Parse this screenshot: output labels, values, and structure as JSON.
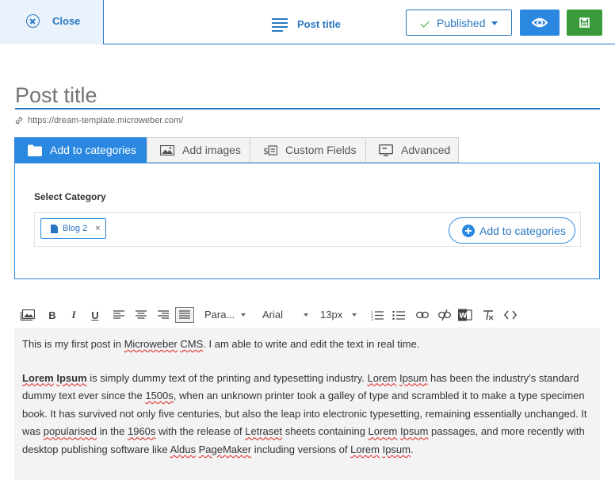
{
  "header": {
    "close_label": "Close",
    "title_label": "Post title",
    "status_label": "Published",
    "colors": {
      "accent": "#2b78c2",
      "primary": "#2b88e0",
      "save": "#3a9b3c"
    }
  },
  "post": {
    "title_placeholder": "Post title",
    "url": "https://dream-template.microweber.com/"
  },
  "tabs": [
    {
      "label": "Add to categories",
      "icon": "folder-icon"
    },
    {
      "label": "Add images",
      "icon": "image-icon"
    },
    {
      "label": "Custom Fields",
      "icon": "custom-fields-icon"
    },
    {
      "label": "Advanced",
      "icon": "monitor-icon"
    }
  ],
  "categories": {
    "heading": "Select Category",
    "selected": [
      {
        "label": "Blog 2",
        "remove": "×"
      }
    ],
    "add_button": "Add to categories"
  },
  "toolbar": {
    "paragraph": "Para...",
    "font": "Arial",
    "size": "13px"
  },
  "editor": {
    "p1": {
      "a": "This is my first post in ",
      "b": "Microweber",
      "c": " ",
      "d": "CMS",
      "e": ". I am able to write and edit the text in real time."
    },
    "p2": {
      "lorem": "Lorem",
      "ipsum": "Ipsum",
      "t1": " is simply dummy text of the printing and typesetting industry. ",
      "t2": " has been the industry's standard dummy text ever since the ",
      "s1500": "1500s",
      "t3": ", when an unknown printer took a galley of type and scrambled it to make a type specimen book. It has survived not only five centuries, but also the leap into electronic typesetting, remaining essentially unchanged. It was ",
      "popularised": "popularised",
      "t4": " in the ",
      "s1960": "1960s",
      "t5": " with the release of ",
      "letraset": "Letraset",
      "t6": " sheets containing ",
      "t7": " passages, and more recently with desktop publishing software like ",
      "aldus": "Aldus",
      "pagemaker": "PageMaker",
      "t8": " including versions of ",
      "t9": "."
    }
  }
}
